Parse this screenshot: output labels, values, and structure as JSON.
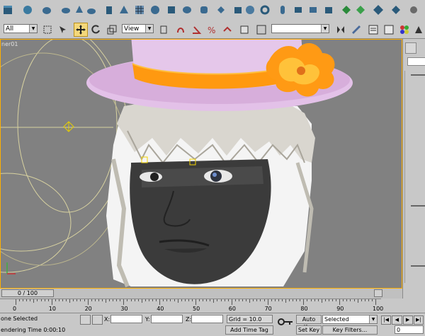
{
  "toolbar": {
    "selection_filter": "All",
    "reference_coord": "View",
    "named_selection": ""
  },
  "viewport": {
    "label": "ner01",
    "border_color": "#ffb000"
  },
  "timeline": {
    "slider_label": "0 / 100",
    "ticks": [
      "0",
      "10",
      "20",
      "30",
      "40",
      "50",
      "60",
      "70",
      "80",
      "90",
      "100"
    ]
  },
  "status": {
    "selection_text": "one Selected",
    "rendering_text": "endering Time 0:00:10",
    "x_label": "X:",
    "y_label": "Y:",
    "z_label": "Z:",
    "grid_text": "Grid = 10.0",
    "add_time_tag": "Add Time Tag",
    "auto_key": "Auto Key",
    "set_key": "Set Key",
    "key_mode_value": "Selected",
    "key_filters": "Key Filters...",
    "frame_value": "0"
  }
}
